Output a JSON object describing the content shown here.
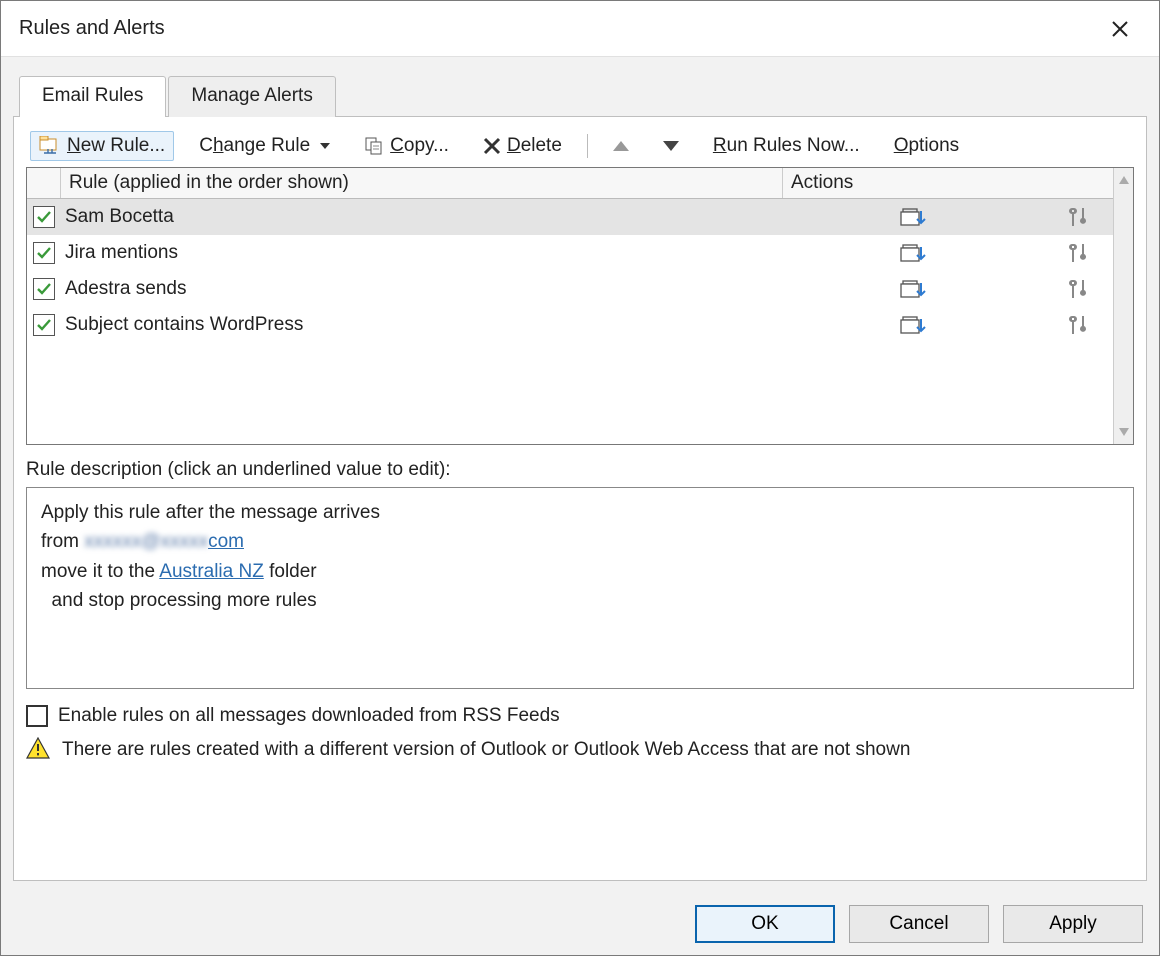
{
  "window": {
    "title": "Rules and Alerts"
  },
  "tabs": {
    "email_rules": "Email Rules",
    "manage_alerts": "Manage Alerts",
    "active": "email_rules"
  },
  "toolbar": {
    "new_rule_u": "N",
    "new_rule_rest": "ew Rule...",
    "change_rule_u": "h",
    "change_rule_pre": "C",
    "change_rule_post": "ange Rule",
    "copy_u": "C",
    "copy_rest": "opy...",
    "delete_u": "D",
    "delete_rest": "elete",
    "run_rules_u": "R",
    "run_rules_rest": "un Rules Now...",
    "options_u": "O",
    "options_rest": "ptions"
  },
  "rules_list": {
    "col_rule": "Rule (applied in the order shown)",
    "col_actions": "Actions",
    "rows": [
      {
        "name": "Sam Bocetta",
        "enabled": true
      },
      {
        "name": "Jira mentions",
        "enabled": true
      },
      {
        "name": "Adestra sends",
        "enabled": true
      },
      {
        "name": "Subject contains WordPress",
        "enabled": true
      }
    ],
    "selected_index": 0
  },
  "description": {
    "label": "Rule description (click an underlined value to edit):",
    "line1": "Apply this rule after the message arrives",
    "line2_pre": "from ",
    "line2_from_blurred": "xxxxxx@xxxxx",
    "line2_from_suffix": "com",
    "line3_pre": "move it to the ",
    "line3_folder": " Australia NZ",
    "line3_post": " folder",
    "line4": "  and stop processing more rules"
  },
  "rss": {
    "label": "Enable rules on all messages downloaded from RSS Feeds",
    "checked": false
  },
  "warning": {
    "text": "There are rules created with a different version of Outlook or Outlook Web Access that are not shown"
  },
  "buttons": {
    "ok": "OK",
    "cancel": "Cancel",
    "apply": "Apply"
  }
}
